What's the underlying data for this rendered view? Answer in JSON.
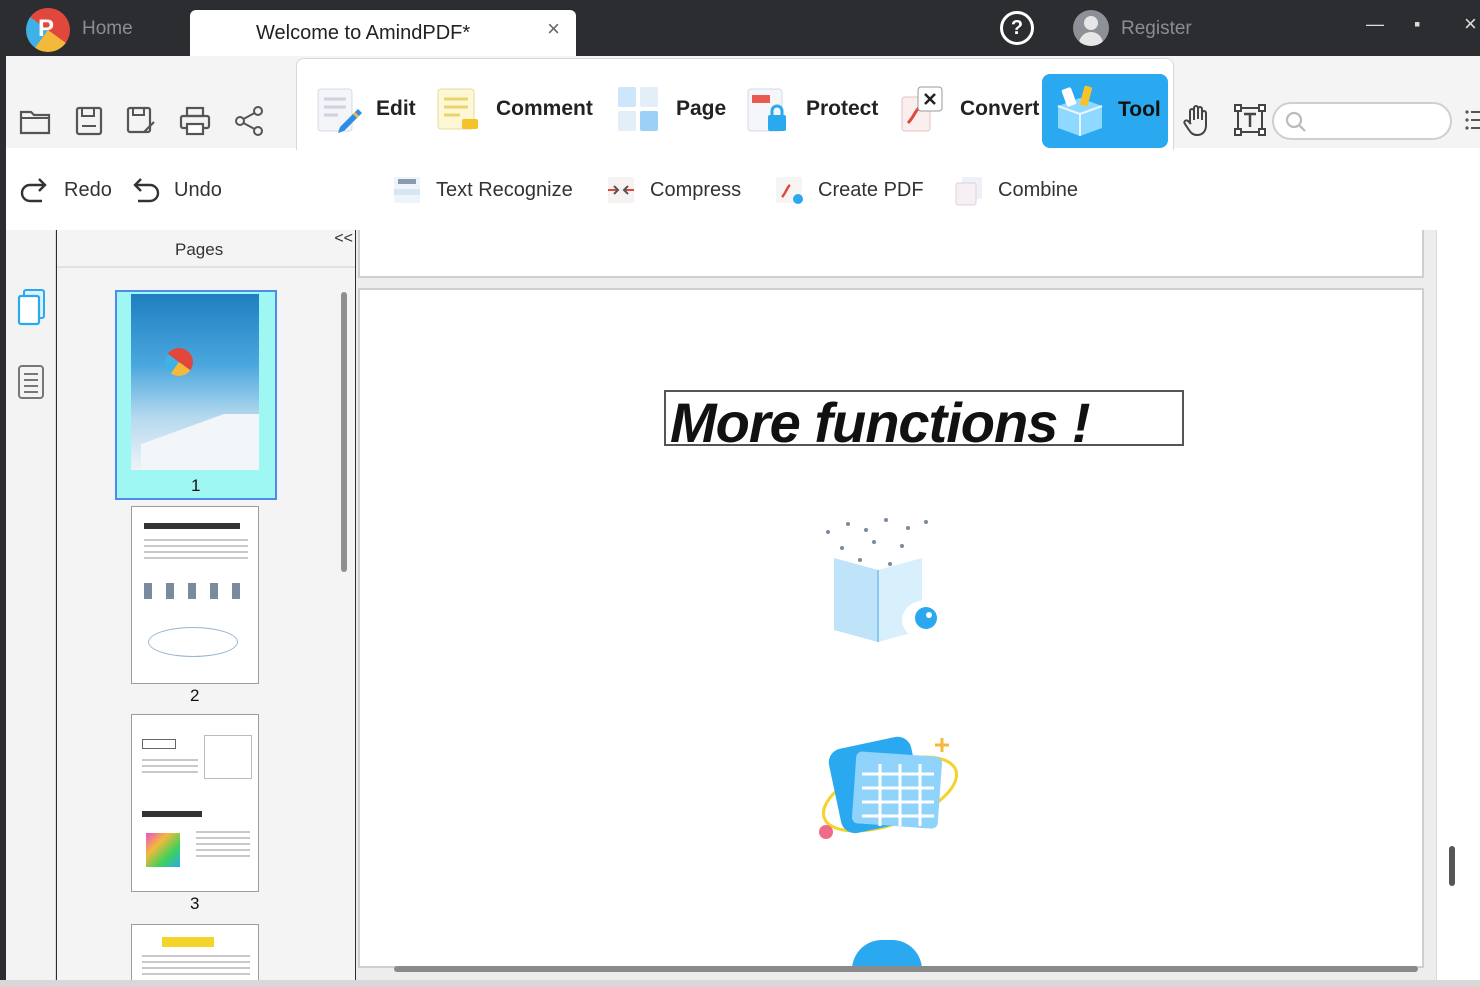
{
  "titlebar": {
    "home_tab": "Home",
    "doc_tab": "Welcome to AmindPDF*",
    "close_glyph": "×",
    "register": "Register",
    "help_glyph": "?",
    "minimize_glyph": "—",
    "maximize_glyph": "▪",
    "close_window_glyph": "×"
  },
  "ribbon": {
    "tabs": [
      {
        "label": "Edit",
        "icon": "edit-icon"
      },
      {
        "label": "Comment",
        "icon": "comment-icon"
      },
      {
        "label": "Page",
        "icon": "page-icon"
      },
      {
        "label": "Protect",
        "icon": "protect-icon"
      },
      {
        "label": "Convert",
        "icon": "convert-icon"
      },
      {
        "label": "Tool",
        "icon": "tool-icon",
        "active": true
      }
    ],
    "accent_color": "#2aa9f0"
  },
  "subtoolbar": {
    "redo": "Redo",
    "undo": "Undo",
    "text_recognize": "Text Recognize",
    "compress": "Compress",
    "create_pdf": "Create PDF",
    "combine": "Combine"
  },
  "pages_panel": {
    "title": "Pages",
    "collapse_glyph": "<<",
    "thumbnails": [
      {
        "number": "1",
        "selected": true
      },
      {
        "number": "2"
      },
      {
        "number": "3"
      }
    ]
  },
  "document": {
    "headline": "More functions",
    "headline_suffix": "!"
  }
}
